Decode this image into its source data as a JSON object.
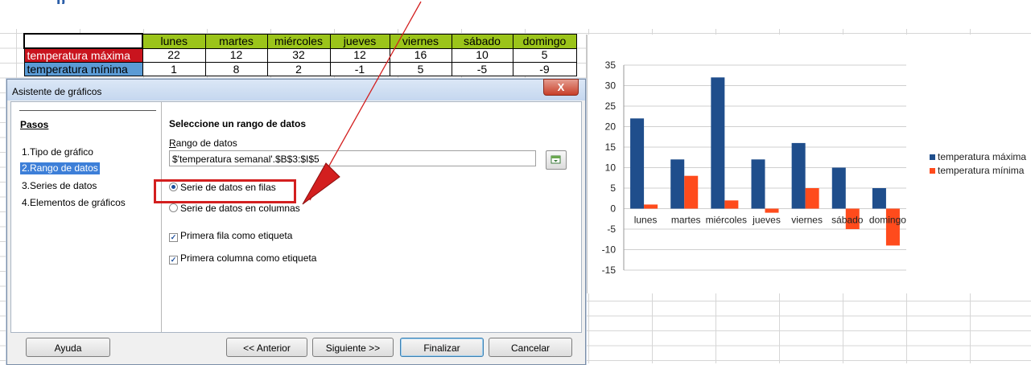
{
  "colors": {
    "bar_max": "#1f4e8c",
    "bar_min": "#ff4b1c",
    "header_green": "#9bc41a",
    "label_red": "#c9141e",
    "label_blue": "#5b9bd5",
    "annotation_red": "#d31f1f"
  },
  "heading_fragment": "p",
  "table": {
    "days": [
      "lunes",
      "martes",
      "miércoles",
      "jueves",
      "viernes",
      "sábado",
      "domingo"
    ],
    "rows": [
      {
        "label": "temperatura máxima",
        "values": [
          "22",
          "12",
          "32",
          "12",
          "16",
          "10",
          "5"
        ]
      },
      {
        "label": "temperatura mínima",
        "values": [
          "1",
          "8",
          "2",
          "-1",
          "5",
          "-5",
          "-9"
        ]
      }
    ]
  },
  "dialog": {
    "title": "Asistente de gráficos",
    "close_glyph": "X",
    "steps_title": "Pasos",
    "steps": [
      "1.Tipo de gráfico",
      "2.Rango de datos",
      "3.Series de datos",
      "4.Elementos de gráficos"
    ],
    "content_title": "Seleccione un rango de datos",
    "range_label": "Rango de datos",
    "range_value": "$'temperatura semanal'.$B$3:$I$5",
    "option_rows": "Serie de datos en filas",
    "option_columns": "Serie de datos en columnas",
    "check_first_row": "Primera fila como etiqueta",
    "check_first_col": "Primera columna como etiqueta",
    "buttons": {
      "help": "Ayuda",
      "back": "<< Anterior",
      "next": "Siguiente >>",
      "finish": "Finalizar",
      "cancel": "Cancelar"
    }
  },
  "chart_data": {
    "type": "bar",
    "categories": [
      "lunes",
      "martes",
      "miércoles",
      "jueves",
      "viernes",
      "sábado",
      "domingo"
    ],
    "series": [
      {
        "name": "temperatura máxima",
        "values": [
          22,
          12,
          32,
          12,
          16,
          10,
          5
        ]
      },
      {
        "name": "temperatura mínima",
        "values": [
          1,
          8,
          2,
          -1,
          5,
          -5,
          -9
        ]
      }
    ],
    "ylim": [
      -15,
      35
    ],
    "yticks": [
      35,
      30,
      25,
      20,
      15,
      10,
      5,
      0,
      -5,
      -10,
      -15
    ],
    "grid": true,
    "legend": "right"
  }
}
